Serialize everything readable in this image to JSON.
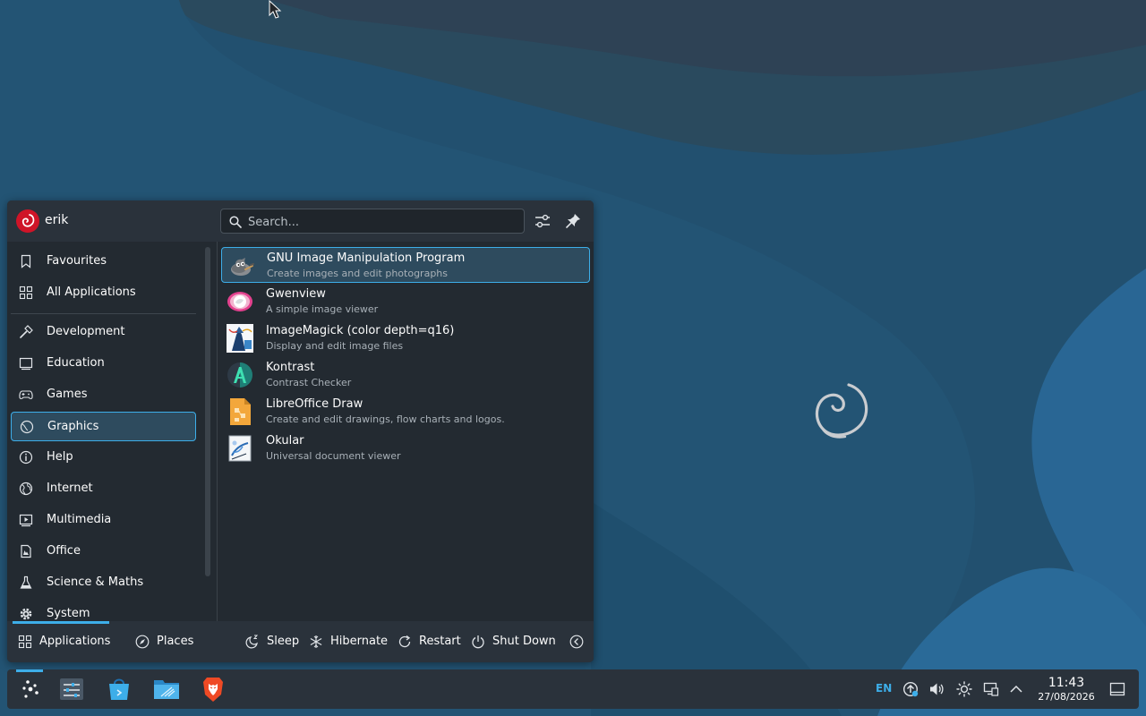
{
  "launcher": {
    "user_name": "erik",
    "search_placeholder": "Search...",
    "categories": [
      {
        "label": "Favourites",
        "icon": "bookmark-icon"
      },
      {
        "label": "All Applications",
        "icon": "grid-icon"
      },
      {
        "label": "Development",
        "icon": "hammer-icon"
      },
      {
        "label": "Education",
        "icon": "monitor-icon"
      },
      {
        "label": "Games",
        "icon": "gamepad-icon"
      },
      {
        "label": "Graphics",
        "icon": "graphics-icon",
        "active": true
      },
      {
        "label": "Help",
        "icon": "help-icon"
      },
      {
        "label": "Internet",
        "icon": "globe-icon"
      },
      {
        "label": "Multimedia",
        "icon": "multimedia-icon"
      },
      {
        "label": "Office",
        "icon": "document-icon"
      },
      {
        "label": "Science & Maths",
        "icon": "flask-icon"
      },
      {
        "label": "System",
        "icon": "gear-icon"
      }
    ],
    "apps": [
      {
        "name": "GNU Image Manipulation Program",
        "description": "Create images and edit photographs",
        "icon": "gimp-icon"
      },
      {
        "name": "Gwenview",
        "description": "A simple image viewer",
        "icon": "gwenview-icon"
      },
      {
        "name": "ImageMagick (color depth=q16)",
        "description": "Display and edit image files",
        "icon": "imagemagick-icon"
      },
      {
        "name": "Kontrast",
        "description": "Contrast Checker",
        "icon": "kontrast-icon"
      },
      {
        "name": "LibreOffice Draw",
        "description": "Create and edit drawings, flow charts and logos.",
        "icon": "libreoffice-draw-icon"
      },
      {
        "name": "Okular",
        "description": "Universal document viewer",
        "icon": "okular-icon"
      }
    ],
    "footer": {
      "applications_label": "Applications",
      "places_label": "Places",
      "sleep_label": "Sleep",
      "hibernate_label": "Hibernate",
      "restart_label": "Restart",
      "shutdown_label": "Shut Down"
    }
  },
  "panel": {
    "language": "EN",
    "time": "11:43",
    "date": "27/08/2026"
  },
  "colors": {
    "accent": "#3daee9",
    "panel_bg": "#2a323b",
    "menu_bg": "#232a31",
    "debian_red": "#cf1428"
  }
}
